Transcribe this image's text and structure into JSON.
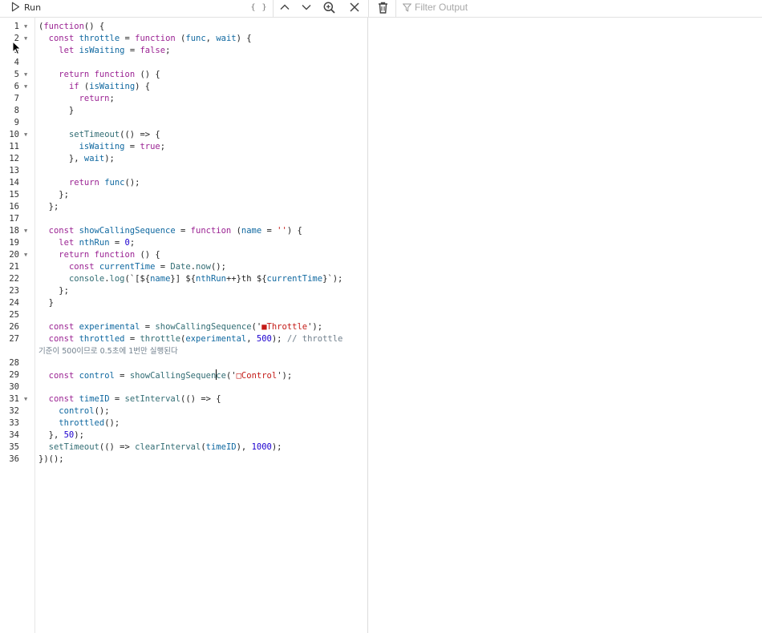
{
  "toolbar": {
    "run_label": "Run",
    "braces_label": "{ }",
    "filter_placeholder": "Filter Output",
    "icons": [
      "play-icon",
      "braces-icon",
      "chevron-up-icon",
      "chevron-down-icon",
      "search-zoom-icon",
      "close-icon",
      "trash-icon",
      "filter-icon"
    ]
  },
  "editor": {
    "lines": [
      {
        "n": "1",
        "fold": true,
        "t": [
          [
            "(",
            ""
          ],
          [
            "function",
            "k"
          ],
          [
            "() {",
            ""
          ]
        ]
      },
      {
        "n": "2",
        "fold": true,
        "t": [
          [
            "  ",
            ""
          ],
          [
            "const",
            "k"
          ],
          [
            " ",
            ""
          ],
          [
            "throttle",
            "v"
          ],
          [
            " = ",
            ""
          ],
          [
            "function",
            "k"
          ],
          [
            " (",
            ""
          ],
          [
            "func",
            "v"
          ],
          [
            ", ",
            ""
          ],
          [
            "wait",
            "v"
          ],
          [
            ") {",
            ""
          ]
        ]
      },
      {
        "n": "3",
        "t": [
          [
            "    ",
            ""
          ],
          [
            "let",
            "k"
          ],
          [
            " ",
            ""
          ],
          [
            "isWaiting",
            "v"
          ],
          [
            " = ",
            ""
          ],
          [
            "false",
            "k"
          ],
          [
            ";",
            ""
          ]
        ]
      },
      {
        "n": "4",
        "t": []
      },
      {
        "n": "5",
        "fold": true,
        "t": [
          [
            "    ",
            ""
          ],
          [
            "return",
            "k"
          ],
          [
            " ",
            ""
          ],
          [
            "function",
            "k"
          ],
          [
            " () {",
            ""
          ]
        ]
      },
      {
        "n": "6",
        "fold": true,
        "t": [
          [
            "      ",
            ""
          ],
          [
            "if",
            "k"
          ],
          [
            " (",
            ""
          ],
          [
            "isWaiting",
            "v"
          ],
          [
            ") {",
            ""
          ]
        ]
      },
      {
        "n": "7",
        "t": [
          [
            "        ",
            ""
          ],
          [
            "return",
            "k"
          ],
          [
            ";",
            ""
          ]
        ]
      },
      {
        "n": "8",
        "t": [
          [
            "      }",
            ""
          ]
        ]
      },
      {
        "n": "9",
        "t": []
      },
      {
        "n": "10",
        "fold": true,
        "t": [
          [
            "      ",
            ""
          ],
          [
            "setTimeout",
            "f"
          ],
          [
            "(() => {",
            ""
          ]
        ]
      },
      {
        "n": "11",
        "t": [
          [
            "        ",
            ""
          ],
          [
            "isWaiting",
            "v"
          ],
          [
            " = ",
            ""
          ],
          [
            "true",
            "k"
          ],
          [
            ";",
            ""
          ]
        ]
      },
      {
        "n": "12",
        "t": [
          [
            "      }, ",
            ""
          ],
          [
            "wait",
            "v"
          ],
          [
            ");",
            ""
          ]
        ]
      },
      {
        "n": "13",
        "t": []
      },
      {
        "n": "14",
        "t": [
          [
            "      ",
            ""
          ],
          [
            "return",
            "k"
          ],
          [
            " ",
            ""
          ],
          [
            "func",
            "v"
          ],
          [
            "();",
            ""
          ]
        ]
      },
      {
        "n": "15",
        "t": [
          [
            "    };",
            ""
          ]
        ]
      },
      {
        "n": "16",
        "t": [
          [
            "  };",
            ""
          ]
        ]
      },
      {
        "n": "17",
        "t": []
      },
      {
        "n": "18",
        "fold": true,
        "t": [
          [
            "  ",
            ""
          ],
          [
            "const",
            "k"
          ],
          [
            " ",
            ""
          ],
          [
            "showCallingSequence",
            "v"
          ],
          [
            " = ",
            ""
          ],
          [
            "function",
            "k"
          ],
          [
            " (",
            ""
          ],
          [
            "name",
            "v"
          ],
          [
            " = ",
            ""
          ],
          [
            "''",
            "s"
          ],
          [
            ") {",
            ""
          ]
        ]
      },
      {
        "n": "19",
        "t": [
          [
            "    ",
            ""
          ],
          [
            "let",
            "k"
          ],
          [
            " ",
            ""
          ],
          [
            "nthRun",
            "v"
          ],
          [
            " = ",
            ""
          ],
          [
            "0",
            "n"
          ],
          [
            ";",
            ""
          ]
        ]
      },
      {
        "n": "20",
        "fold": true,
        "t": [
          [
            "    ",
            ""
          ],
          [
            "return",
            "k"
          ],
          [
            " ",
            ""
          ],
          [
            "function",
            "k"
          ],
          [
            " () {",
            ""
          ]
        ]
      },
      {
        "n": "21",
        "t": [
          [
            "      ",
            ""
          ],
          [
            "const",
            "k"
          ],
          [
            " ",
            ""
          ],
          [
            "currentTime",
            "v"
          ],
          [
            " = ",
            ""
          ],
          [
            "Date",
            "f"
          ],
          [
            ".",
            ""
          ],
          [
            "now",
            "f"
          ],
          [
            "();",
            ""
          ]
        ]
      },
      {
        "n": "22",
        "t": [
          [
            "      ",
            ""
          ],
          [
            "console",
            "f"
          ],
          [
            ".",
            ""
          ],
          [
            "log",
            "f"
          ],
          [
            "(`[${",
            ""
          ],
          [
            "name",
            "v"
          ],
          [
            "}] ${",
            ""
          ],
          [
            "nthRun",
            "v"
          ],
          [
            "++}th ${",
            ""
          ],
          [
            "currentTime",
            "v"
          ],
          [
            "}`);",
            ""
          ]
        ]
      },
      {
        "n": "23",
        "t": [
          [
            "    };",
            ""
          ]
        ]
      },
      {
        "n": "24",
        "t": [
          [
            "  }",
            ""
          ]
        ]
      },
      {
        "n": "25",
        "t": []
      },
      {
        "n": "26",
        "t": [
          [
            "  ",
            ""
          ],
          [
            "const",
            "k"
          ],
          [
            " ",
            ""
          ],
          [
            "experimental",
            "v"
          ],
          [
            " = ",
            ""
          ],
          [
            "showCallingSequence",
            "f"
          ],
          [
            "('",
            ""
          ],
          [
            "■Throttle",
            "s"
          ],
          [
            "');",
            ""
          ]
        ]
      },
      {
        "n": "27",
        "t": [
          [
            "  ",
            ""
          ],
          [
            "const",
            "k"
          ],
          [
            " ",
            ""
          ],
          [
            "throttled",
            "v"
          ],
          [
            " = ",
            ""
          ],
          [
            "throttle",
            "f"
          ],
          [
            "(",
            ""
          ],
          [
            "experimental",
            "v"
          ],
          [
            ", ",
            ""
          ],
          [
            "500",
            "n"
          ],
          [
            "); ",
            ""
          ],
          [
            "// throttle",
            "c"
          ]
        ]
      },
      {
        "n": "",
        "cont": true,
        "t": [
          [
            "기준이 500이므로 0.5초에 1번만 실행된다",
            "c"
          ]
        ]
      },
      {
        "n": "28",
        "t": []
      },
      {
        "n": "29",
        "caret": true,
        "t": [
          [
            "  ",
            ""
          ],
          [
            "const",
            "k"
          ],
          [
            " ",
            ""
          ],
          [
            "control",
            "v"
          ],
          [
            " = ",
            ""
          ],
          [
            "showCallingSequen",
            "f"
          ],
          [
            "ce",
            "f"
          ],
          [
            "('",
            ""
          ],
          [
            "□Control",
            "s"
          ],
          [
            "');",
            ""
          ]
        ]
      },
      {
        "n": "30",
        "t": []
      },
      {
        "n": "31",
        "fold": true,
        "t": [
          [
            "  ",
            ""
          ],
          [
            "const",
            "k"
          ],
          [
            " ",
            ""
          ],
          [
            "timeID",
            "v"
          ],
          [
            " = ",
            ""
          ],
          [
            "setInterval",
            "f"
          ],
          [
            "(() => {",
            ""
          ]
        ]
      },
      {
        "n": "32",
        "t": [
          [
            "    ",
            ""
          ],
          [
            "control",
            "v"
          ],
          [
            "();",
            ""
          ]
        ]
      },
      {
        "n": "33",
        "t": [
          [
            "    ",
            ""
          ],
          [
            "throttled",
            "v"
          ],
          [
            "();",
            ""
          ]
        ]
      },
      {
        "n": "34",
        "t": [
          [
            "  }, ",
            ""
          ],
          [
            "50",
            "n"
          ],
          [
            ");",
            ""
          ]
        ]
      },
      {
        "n": "35",
        "t": [
          [
            "  ",
            ""
          ],
          [
            "setTimeout",
            "f"
          ],
          [
            "(() => ",
            ""
          ],
          [
            "clearInterval",
            "f"
          ],
          [
            "(",
            ""
          ],
          [
            "timeID",
            "v"
          ],
          [
            "), ",
            ""
          ],
          [
            "1000",
            "n"
          ],
          [
            ");",
            ""
          ]
        ]
      },
      {
        "n": "36",
        "t": [
          [
            "})();",
            ""
          ]
        ]
      }
    ]
  },
  "console": {
    "entries": []
  }
}
